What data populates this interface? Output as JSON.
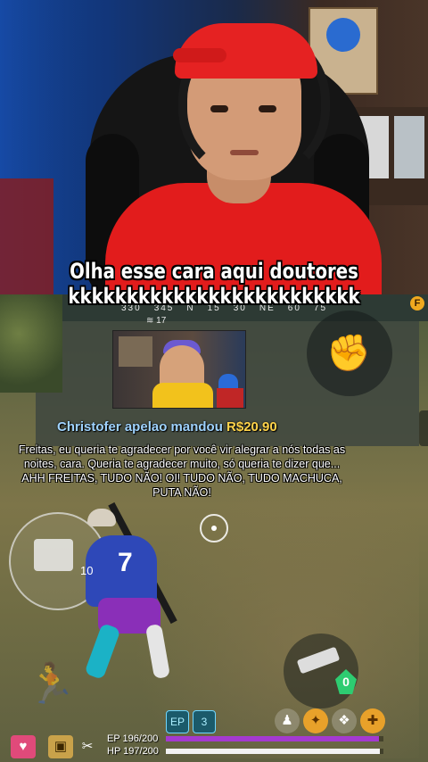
{
  "caption": {
    "line1": "Olha esse cara aqui doutores",
    "line2": "kkkkkkkkkkkkkkkkkkkkkkkkk"
  },
  "hud": {
    "compass": [
      "330",
      "345",
      "N",
      "15",
      "30",
      "NE",
      "60",
      "75"
    ],
    "wifi_ping": "17",
    "corner_badge": "F"
  },
  "donation": {
    "donor_text": "Christofer apelao mandou",
    "amount": "R$20.90",
    "message": "Freitas, eu queria te agradecer por você vir alegrar a nós todas as noites, cara. Queria te agradecer muito, só queria te dizer que... AHH FREITAS, TUDO NÃO! OI! TUDO NÃO, TUDO MACHUCA, PUTA NÃO!"
  },
  "player": {
    "jersey_number": "7",
    "level_tag": "10"
  },
  "weapon": {
    "ammo": "0"
  },
  "status": {
    "ep_label": "EP",
    "ep_value": "196/200",
    "ep_fraction": 0.98,
    "hp_label": "HP",
    "hp_value": "197/200",
    "hp_fraction": 0.985
  },
  "skills": [
    "EP",
    "3"
  ],
  "colors": {
    "cap": "#e52222",
    "shirt": "#e21c1c",
    "ep_bar": "#a43ad0",
    "hp_bar": "#f2f2f2",
    "donor": "#9fd3ff",
    "amount": "#ffd34a"
  },
  "icons": [
    "fist-icon",
    "crosshair-icon",
    "run-icon",
    "rifle-icon",
    "wifi-icon",
    "medkit-icon",
    "grenade-icon",
    "gloo-wall-icon"
  ]
}
